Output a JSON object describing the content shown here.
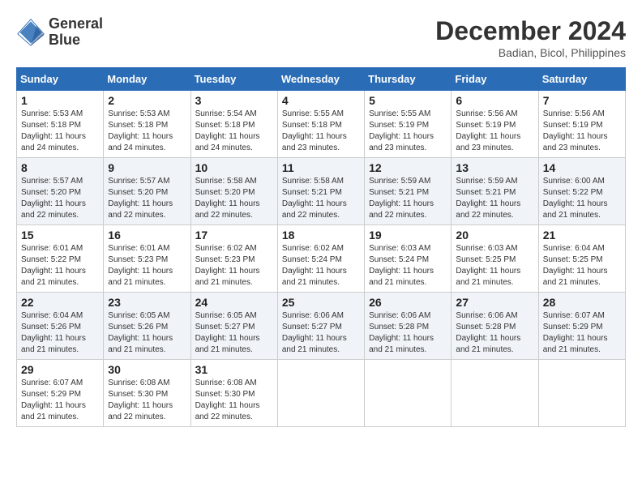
{
  "header": {
    "logo_line1": "General",
    "logo_line2": "Blue",
    "month": "December 2024",
    "location": "Badian, Bicol, Philippines"
  },
  "weekdays": [
    "Sunday",
    "Monday",
    "Tuesday",
    "Wednesday",
    "Thursday",
    "Friday",
    "Saturday"
  ],
  "weeks": [
    [
      {
        "day": "1",
        "sunrise": "5:53 AM",
        "sunset": "5:18 PM",
        "daylight": "11 hours and 24 minutes."
      },
      {
        "day": "2",
        "sunrise": "5:53 AM",
        "sunset": "5:18 PM",
        "daylight": "11 hours and 24 minutes."
      },
      {
        "day": "3",
        "sunrise": "5:54 AM",
        "sunset": "5:18 PM",
        "daylight": "11 hours and 24 minutes."
      },
      {
        "day": "4",
        "sunrise": "5:55 AM",
        "sunset": "5:18 PM",
        "daylight": "11 hours and 23 minutes."
      },
      {
        "day": "5",
        "sunrise": "5:55 AM",
        "sunset": "5:19 PM",
        "daylight": "11 hours and 23 minutes."
      },
      {
        "day": "6",
        "sunrise": "5:56 AM",
        "sunset": "5:19 PM",
        "daylight": "11 hours and 23 minutes."
      },
      {
        "day": "7",
        "sunrise": "5:56 AM",
        "sunset": "5:19 PM",
        "daylight": "11 hours and 23 minutes."
      }
    ],
    [
      {
        "day": "8",
        "sunrise": "5:57 AM",
        "sunset": "5:20 PM",
        "daylight": "11 hours and 22 minutes."
      },
      {
        "day": "9",
        "sunrise": "5:57 AM",
        "sunset": "5:20 PM",
        "daylight": "11 hours and 22 minutes."
      },
      {
        "day": "10",
        "sunrise": "5:58 AM",
        "sunset": "5:20 PM",
        "daylight": "11 hours and 22 minutes."
      },
      {
        "day": "11",
        "sunrise": "5:58 AM",
        "sunset": "5:21 PM",
        "daylight": "11 hours and 22 minutes."
      },
      {
        "day": "12",
        "sunrise": "5:59 AM",
        "sunset": "5:21 PM",
        "daylight": "11 hours and 22 minutes."
      },
      {
        "day": "13",
        "sunrise": "5:59 AM",
        "sunset": "5:21 PM",
        "daylight": "11 hours and 22 minutes."
      },
      {
        "day": "14",
        "sunrise": "6:00 AM",
        "sunset": "5:22 PM",
        "daylight": "11 hours and 21 minutes."
      }
    ],
    [
      {
        "day": "15",
        "sunrise": "6:01 AM",
        "sunset": "5:22 PM",
        "daylight": "11 hours and 21 minutes."
      },
      {
        "day": "16",
        "sunrise": "6:01 AM",
        "sunset": "5:23 PM",
        "daylight": "11 hours and 21 minutes."
      },
      {
        "day": "17",
        "sunrise": "6:02 AM",
        "sunset": "5:23 PM",
        "daylight": "11 hours and 21 minutes."
      },
      {
        "day": "18",
        "sunrise": "6:02 AM",
        "sunset": "5:24 PM",
        "daylight": "11 hours and 21 minutes."
      },
      {
        "day": "19",
        "sunrise": "6:03 AM",
        "sunset": "5:24 PM",
        "daylight": "11 hours and 21 minutes."
      },
      {
        "day": "20",
        "sunrise": "6:03 AM",
        "sunset": "5:25 PM",
        "daylight": "11 hours and 21 minutes."
      },
      {
        "day": "21",
        "sunrise": "6:04 AM",
        "sunset": "5:25 PM",
        "daylight": "11 hours and 21 minutes."
      }
    ],
    [
      {
        "day": "22",
        "sunrise": "6:04 AM",
        "sunset": "5:26 PM",
        "daylight": "11 hours and 21 minutes."
      },
      {
        "day": "23",
        "sunrise": "6:05 AM",
        "sunset": "5:26 PM",
        "daylight": "11 hours and 21 minutes."
      },
      {
        "day": "24",
        "sunrise": "6:05 AM",
        "sunset": "5:27 PM",
        "daylight": "11 hours and 21 minutes."
      },
      {
        "day": "25",
        "sunrise": "6:06 AM",
        "sunset": "5:27 PM",
        "daylight": "11 hours and 21 minutes."
      },
      {
        "day": "26",
        "sunrise": "6:06 AM",
        "sunset": "5:28 PM",
        "daylight": "11 hours and 21 minutes."
      },
      {
        "day": "27",
        "sunrise": "6:06 AM",
        "sunset": "5:28 PM",
        "daylight": "11 hours and 21 minutes."
      },
      {
        "day": "28",
        "sunrise": "6:07 AM",
        "sunset": "5:29 PM",
        "daylight": "11 hours and 21 minutes."
      }
    ],
    [
      {
        "day": "29",
        "sunrise": "6:07 AM",
        "sunset": "5:29 PM",
        "daylight": "11 hours and 21 minutes."
      },
      {
        "day": "30",
        "sunrise": "6:08 AM",
        "sunset": "5:30 PM",
        "daylight": "11 hours and 22 minutes."
      },
      {
        "day": "31",
        "sunrise": "6:08 AM",
        "sunset": "5:30 PM",
        "daylight": "11 hours and 22 minutes."
      },
      null,
      null,
      null,
      null
    ]
  ]
}
